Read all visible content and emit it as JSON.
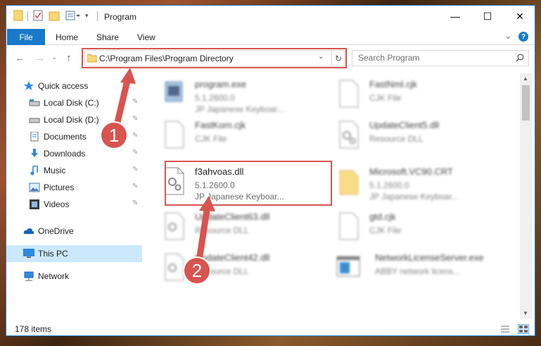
{
  "window": {
    "title": "Program",
    "controls": {
      "minimize": "—",
      "maximize": "☐",
      "close": "✕"
    }
  },
  "ribbon": {
    "tabs": [
      "File",
      "Home",
      "Share",
      "View"
    ],
    "expand_glyph": "⌄",
    "help_glyph": "?"
  },
  "navigation": {
    "back": "←",
    "forward": "→",
    "recent": "⌄",
    "up": "↑",
    "address": "C:\\Program Files\\Program Directory",
    "address_dropdown": "⌄",
    "refresh": "↻",
    "search_placeholder": "Search Program"
  },
  "sidebar": {
    "items": [
      {
        "label": "Quick access",
        "icon": "star-icon",
        "pinned": false
      },
      {
        "label": "Local Disk (C:)",
        "icon": "drive-icon",
        "pinned": true
      },
      {
        "label": "Local Disk (D:)",
        "icon": "drive-icon",
        "pinned": true
      },
      {
        "label": "Documents",
        "icon": "documents-icon",
        "pinned": true
      },
      {
        "label": "Downloads",
        "icon": "download-icon",
        "pinned": true
      },
      {
        "label": "Music",
        "icon": "music-icon",
        "pinned": true
      },
      {
        "label": "Pictures",
        "icon": "pictures-icon",
        "pinned": true
      },
      {
        "label": "Videos",
        "icon": "videos-icon",
        "pinned": true
      },
      {
        "label": "OneDrive",
        "icon": "cloud-icon",
        "pinned": false
      },
      {
        "label": "This PC",
        "icon": "pc-icon",
        "pinned": false,
        "selected": true
      },
      {
        "label": "Network",
        "icon": "network-icon",
        "pinned": false
      }
    ],
    "pin_glyph": "📌"
  },
  "files": [
    {
      "name": "program.exe",
      "line2": "5.1.2600.0",
      "line3": "JP Japanese Keyboar...",
      "icon": "exe-icon"
    },
    {
      "name": "FastNml.cjk",
      "line2": "CJK File",
      "line3": "",
      "icon": "file-icon"
    },
    {
      "name": "FastKorn.cjk",
      "line2": "CJK File",
      "line3": "",
      "icon": "file-icon"
    },
    {
      "name": "UpdateClient5.dll",
      "line2": "Resource DLL",
      "line3": "",
      "icon": "dll-icon"
    },
    {
      "name": "f3ahvoas.dll",
      "line2": "5.1.2600.0",
      "line3": "JP Japanese Keyboar...",
      "icon": "dll-icon",
      "highlighted": true
    },
    {
      "name": "Microsoft.VC90.CRT",
      "line2": "5.1.2600.0",
      "line3": "JP Japanese Keyboar...",
      "icon": "folder-icon"
    },
    {
      "name": "UpdateClient63.dll",
      "line2": "Resource DLL",
      "line3": "",
      "icon": "dll-icon"
    },
    {
      "name": "gtd.cjk",
      "line2": "CJK File",
      "line3": "",
      "icon": "file-icon"
    },
    {
      "name": "UpdateClient42.dll",
      "line2": "Resource DLL",
      "line3": "",
      "icon": "dll-icon"
    },
    {
      "name": "NetworkLicenseServer.exe",
      "line2": "ABBY network licens...",
      "line3": "",
      "icon": "app-icon"
    }
  ],
  "status": {
    "items_count": "178 items"
  },
  "annotations": {
    "step1": "1",
    "step2": "2"
  },
  "colors": {
    "accent": "#1979ca",
    "highlight": "#d9534f",
    "selected": "#cce8ff"
  }
}
